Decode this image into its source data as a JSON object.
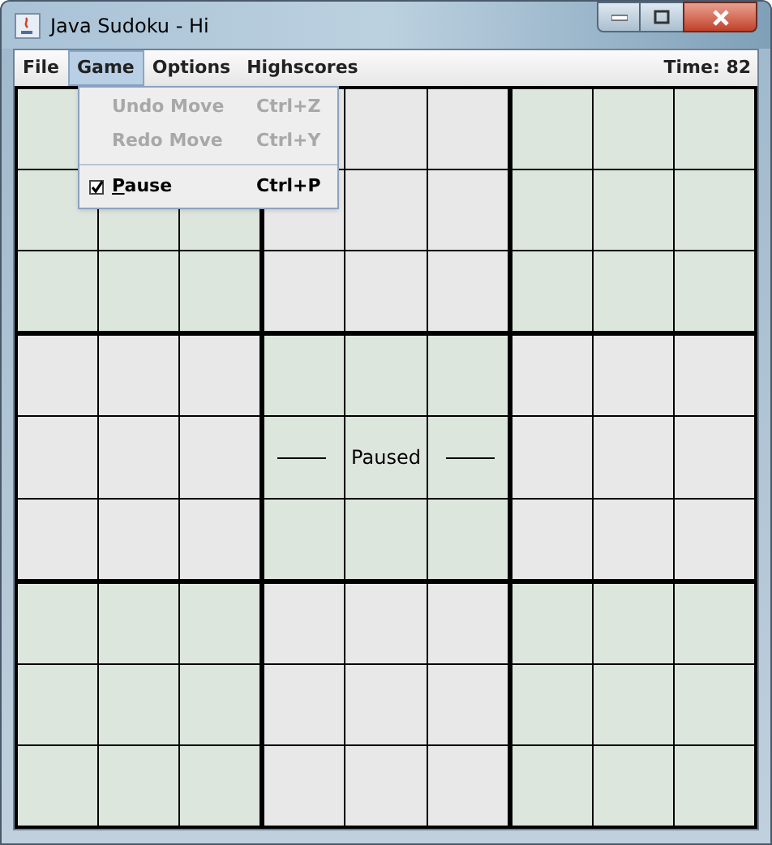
{
  "window": {
    "title": "Java Sudoku - Hi"
  },
  "menu_bar": {
    "items": [
      {
        "label": "File",
        "selected": false
      },
      {
        "label": "Game",
        "selected": true
      },
      {
        "label": "Options",
        "selected": false
      },
      {
        "label": "Highscores",
        "selected": false
      }
    ],
    "timer": "Time: 82"
  },
  "game_menu": {
    "items": [
      {
        "kind": "action",
        "label": "Undo Move",
        "shortcut": "Ctrl+Z",
        "disabled": true
      },
      {
        "kind": "action",
        "label": "Redo Move",
        "shortcut": "Ctrl+Y",
        "disabled": true
      },
      {
        "kind": "separator"
      },
      {
        "kind": "checkbox",
        "label": "Pause",
        "shortcut": "Ctrl+P",
        "disabled": false,
        "checked": true
      }
    ]
  },
  "grid": {
    "boxes": [
      {
        "color": "#dde6dd"
      },
      {
        "color": "#e8e8e8"
      },
      {
        "color": "#dde6dd"
      },
      {
        "color": "#e8e8e8"
      },
      {
        "color": "#dde6dd"
      },
      {
        "color": "#e8e8e8"
      },
      {
        "color": "#dde6dd"
      },
      {
        "color": "#e8e8e8"
      },
      {
        "color": "#dde6dd"
      }
    ],
    "status": "Paused"
  }
}
